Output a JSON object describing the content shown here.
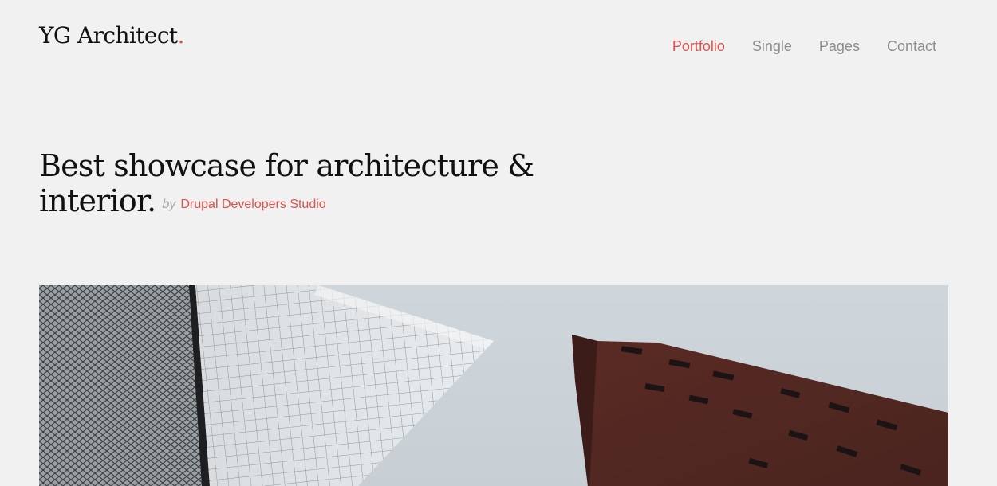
{
  "site": {
    "logo_text": "YG Architect",
    "logo_dot": ".",
    "accent_color": "#e0524c"
  },
  "nav": {
    "items": [
      {
        "label": "Portfolio",
        "active": true
      },
      {
        "label": "Single",
        "active": false
      },
      {
        "label": "Pages",
        "active": false
      },
      {
        "label": "Contact",
        "active": false
      }
    ]
  },
  "hero": {
    "headline": "Best showcase for architecture & interior.",
    "by": "by",
    "author": "Drupal Developers Studio"
  },
  "image": {
    "subject": "low-angle view of glass skyscraper and red brick building against sky"
  }
}
